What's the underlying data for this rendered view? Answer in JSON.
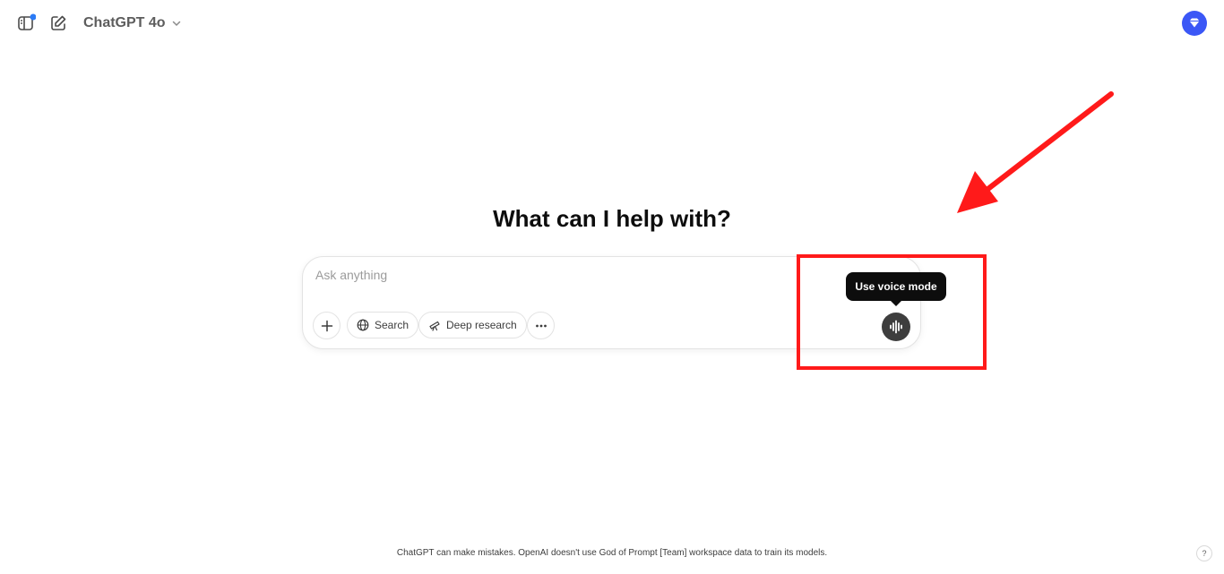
{
  "header": {
    "model_name": "ChatGPT 4o"
  },
  "main": {
    "headline": "What can I help with?",
    "composer": {
      "placeholder": "Ask anything",
      "search_label": "Search",
      "deep_research_label": "Deep research"
    },
    "tooltip": "Use voice mode"
  },
  "footer": {
    "disclaimer": "ChatGPT can make mistakes. OpenAI doesn't use God of Prompt [Team] workspace data to train its models.",
    "help_label": "?"
  },
  "icons": {
    "sidebar_toggle": "sidebar-toggle-icon",
    "new_chat": "edit-icon",
    "model_chevron": "chevron-down-icon",
    "upgrade": "diamond-icon",
    "plus": "plus-icon",
    "search": "globe-icon",
    "deep_research": "telescope-icon",
    "more": "more-icon",
    "voice": "waveform-icon"
  },
  "colors": {
    "annotation": "#ff1a1a",
    "upgrade_badge": "#3b57f6",
    "notification_dot": "#2b7bf6",
    "voice_button": "#3e3e3e"
  }
}
